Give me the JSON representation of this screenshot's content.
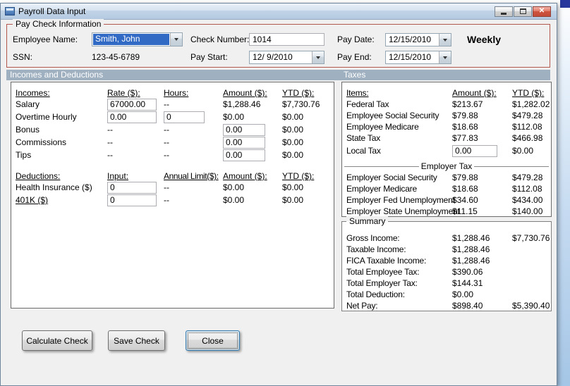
{
  "window": {
    "title": "Payroll Data Input"
  },
  "paycheck": {
    "group_title": "Pay Check Information",
    "employee_name": {
      "label": "Employee Name:",
      "value": "Smith, John"
    },
    "ssn": {
      "label": "SSN:",
      "value": "123-45-6789"
    },
    "check_number": {
      "label": "Check Number:",
      "value": "1014"
    },
    "pay_start": {
      "label": "Pay Start:",
      "value": "12/ 9/2010"
    },
    "pay_date": {
      "label": "Pay Date:",
      "value": "12/15/2010"
    },
    "pay_end": {
      "label": "Pay End:",
      "value": "12/15/2010"
    },
    "frequency": "Weekly"
  },
  "section_headers": {
    "left": "Incomes and Deductions",
    "right": "Taxes"
  },
  "incomes": {
    "headers": {
      "item": "Incomes:",
      "rate": "Rate ($):",
      "hours": "Hours:",
      "amount": "Amount ($):",
      "ytd": "YTD ($):"
    },
    "rows": [
      {
        "label": "Salary",
        "rate": "67000.00",
        "hours": "--",
        "amount": "$1,288.46",
        "ytd": "$7,730.76"
      },
      {
        "label": "Overtime Hourly",
        "rate": "0.00",
        "hours": "0",
        "amount": "$0.00",
        "ytd": "$0.00"
      },
      {
        "label": "Bonus",
        "rate": "--",
        "hours": "--",
        "amount": "0.00",
        "ytd": "$0.00"
      },
      {
        "label": "Commissions",
        "rate": "--",
        "hours": "--",
        "amount": "0.00",
        "ytd": "$0.00"
      },
      {
        "label": "Tips",
        "rate": "--",
        "hours": "--",
        "amount": "0.00",
        "ytd": "$0.00"
      }
    ]
  },
  "deductions": {
    "headers": {
      "item": "Deductions:",
      "input": "Input:",
      "limit": "Annual Limit($):",
      "amount": "Amount ($):",
      "ytd": "YTD ($):"
    },
    "rows": [
      {
        "label": "Health Insurance  ($)",
        "input": "0",
        "limit": "--",
        "amount": "$0.00",
        "ytd": "$0.00"
      },
      {
        "label": "401K  ($)",
        "input": "0",
        "limit": "--",
        "amount": "$0.00",
        "ytd": "$0.00"
      }
    ]
  },
  "taxes": {
    "headers": {
      "item": "Items:",
      "amount": "Amount ($):",
      "ytd": "YTD ($):"
    },
    "rows": [
      {
        "label": "Federal Tax",
        "amount": "$213.67",
        "ytd": "$1,282.02"
      },
      {
        "label": "Employee Social Security",
        "amount": "$79.88",
        "ytd": "$479.28"
      },
      {
        "label": "Employee Medicare",
        "amount": "$18.68",
        "ytd": "$112.08"
      },
      {
        "label": "State Tax",
        "amount": "$77.83",
        "ytd": "$466.98"
      },
      {
        "label": "Local Tax",
        "amount": "0.00",
        "ytd": "$0.00"
      }
    ],
    "employer_title": "Employer Tax",
    "employer_rows": [
      {
        "label": "Employer Social Security",
        "amount": "$79.88",
        "ytd": "$479.28"
      },
      {
        "label": "Employer Medicare",
        "amount": "$18.68",
        "ytd": "$112.08"
      },
      {
        "label": "Employer Fed Unemployment",
        "amount": "$34.60",
        "ytd": "$434.00"
      },
      {
        "label": "Employer State Unemployment",
        "amount": "$11.15",
        "ytd": "$140.00"
      }
    ]
  },
  "summary": {
    "title": "Summary",
    "rows": [
      {
        "label": "Gross Income:",
        "amount": "$1,288.46",
        "ytd": "$7,730.76"
      },
      {
        "label": "Taxable Income:",
        "amount": "$1,288.46",
        "ytd": ""
      },
      {
        "label": "FICA Taxable Income:",
        "amount": "$1,288.46",
        "ytd": ""
      },
      {
        "label": "Total Employee Tax:",
        "amount": "$390.06",
        "ytd": ""
      },
      {
        "label": "Total Employer Tax:",
        "amount": "$144.31",
        "ytd": ""
      },
      {
        "label": "Total Deduction:",
        "amount": "$0.00",
        "ytd": ""
      },
      {
        "label": "Net Pay:",
        "amount": "$898.40",
        "ytd": "$5,390.40"
      }
    ]
  },
  "buttons": {
    "calculate": "Calculate Check",
    "save": "Save Check",
    "close": "Close"
  }
}
